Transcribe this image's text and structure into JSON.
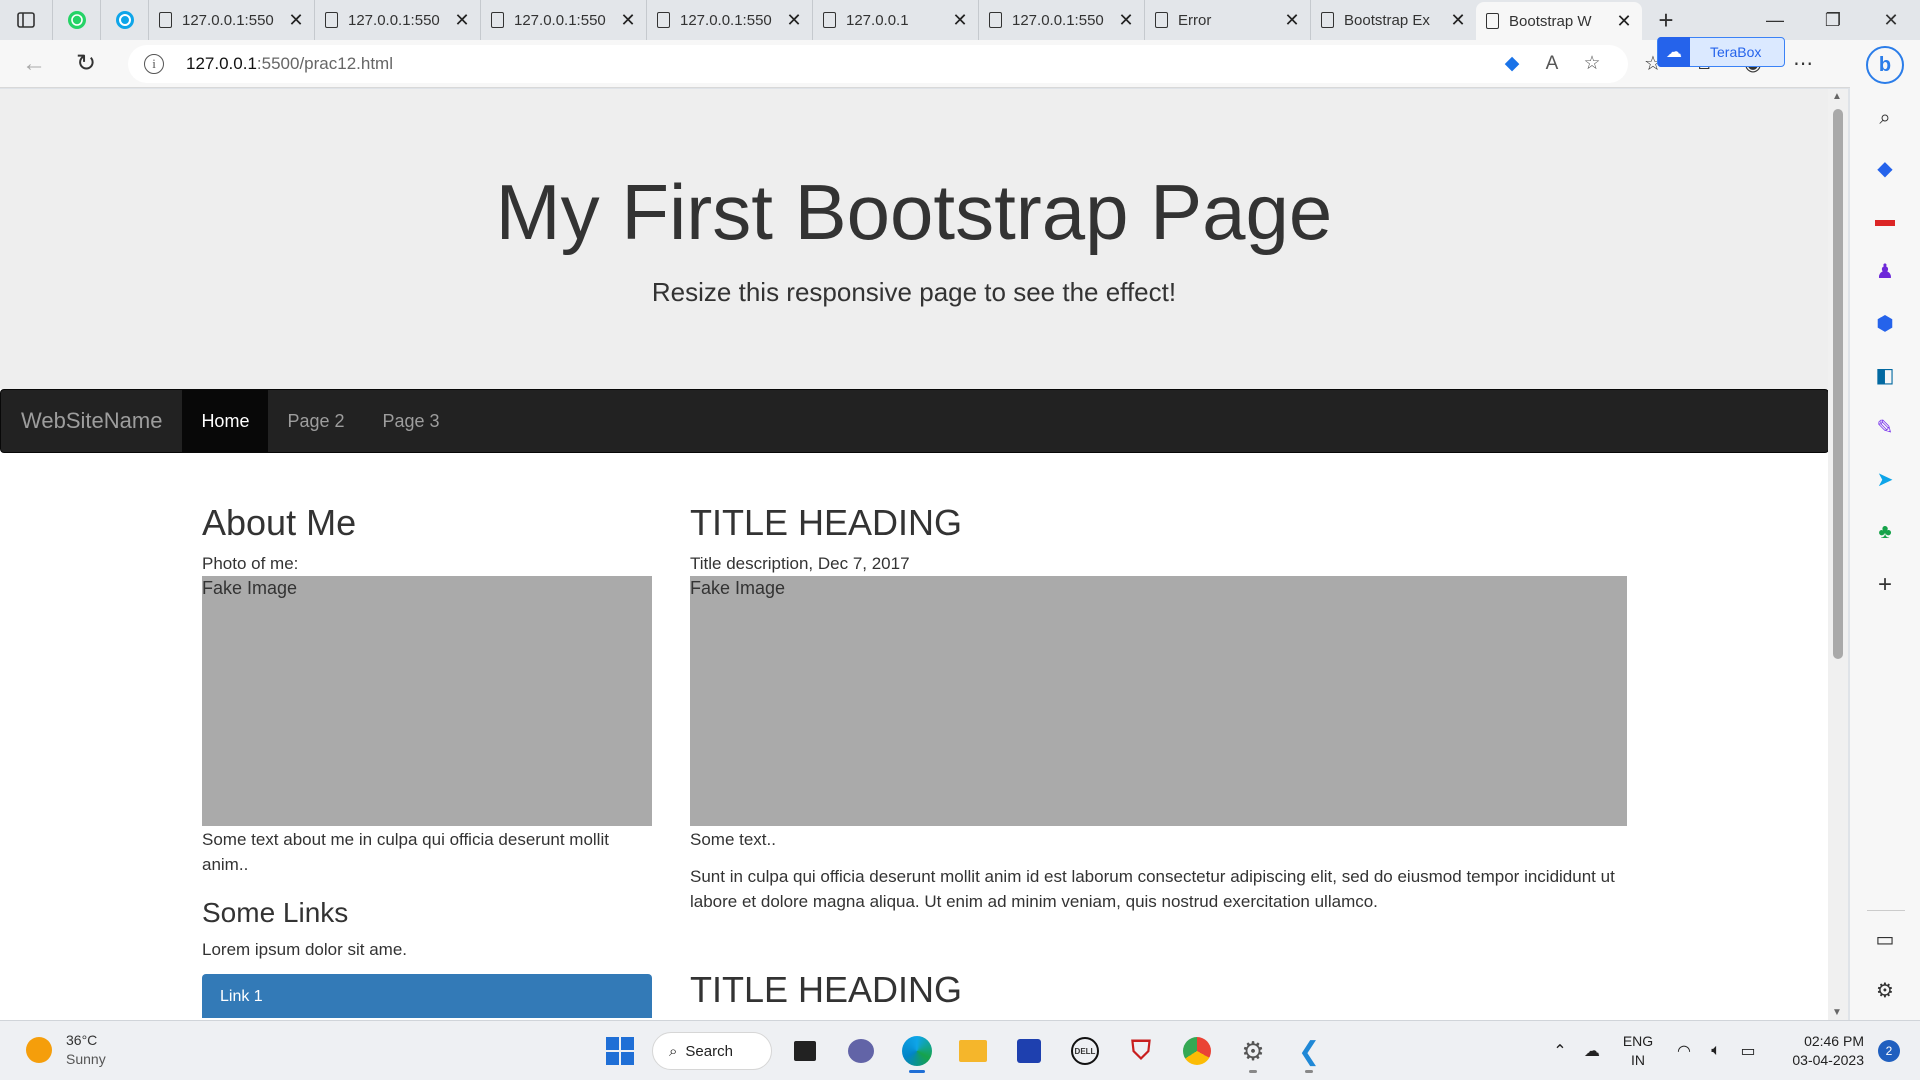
{
  "browser": {
    "tabs": [
      {
        "label": "127.0.0.1:550"
      },
      {
        "label": "127.0.0.1:550"
      },
      {
        "label": "127.0.0.1:550"
      },
      {
        "label": "127.0.0.1:550"
      },
      {
        "label": "127.0.0.1"
      },
      {
        "label": "127.0.0.1:550"
      },
      {
        "label": "Error"
      },
      {
        "label": "Bootstrap Ex"
      },
      {
        "label": "Bootstrap W"
      }
    ],
    "tab_close": "✕",
    "new_tab": "+",
    "url_host": "127.0.0.1",
    "url_path": ":5500/prac12.html",
    "terabox_label": "TeraBox",
    "window": {
      "minimize": "—",
      "maximize": "❐",
      "close": "✕"
    }
  },
  "page": {
    "jumbotron": {
      "title": "My First Bootstrap Page",
      "subtitle": "Resize this responsive page to see the effect!"
    },
    "navbar": {
      "brand": "WebSiteName",
      "links": [
        "Home",
        "Page 2",
        "Page 3"
      ],
      "active": "Home"
    },
    "left": {
      "heading": "About Me",
      "photo_label": "Photo of me:",
      "image_label": "Fake Image",
      "about_text": "Some text about me in culpa qui officia deserunt mollit anim..",
      "links_heading": "Some Links",
      "links_text": "Lorem ipsum dolor sit ame.",
      "link1": "Link 1"
    },
    "right": {
      "heading": "TITLE HEADING",
      "description": "Title description, Dec 7, 2017",
      "image_label": "Fake Image",
      "some_text": "Some text..",
      "paragraph": "Sunt in culpa qui officia deserunt mollit anim id est laborum consectetur adipiscing elit, sed do eiusmod tempor incididunt ut labore et dolore magna aliqua. Ut enim ad minim veniam, quis nostrud exercitation ullamco.",
      "heading2": "TITLE HEADING"
    }
  },
  "taskbar": {
    "weather_temp": "36°C",
    "weather_desc": "Sunny",
    "search_label": "Search",
    "lang_line1": "ENG",
    "lang_line2": "IN",
    "time": "02:46 PM",
    "date": "03-04-2023",
    "notification_count": "2"
  },
  "colors": {
    "navbar_bg": "#222222",
    "jumbotron_bg": "#eeeeee",
    "fake_image_bg": "#aaaaaa",
    "link_button": "#337ab7"
  }
}
